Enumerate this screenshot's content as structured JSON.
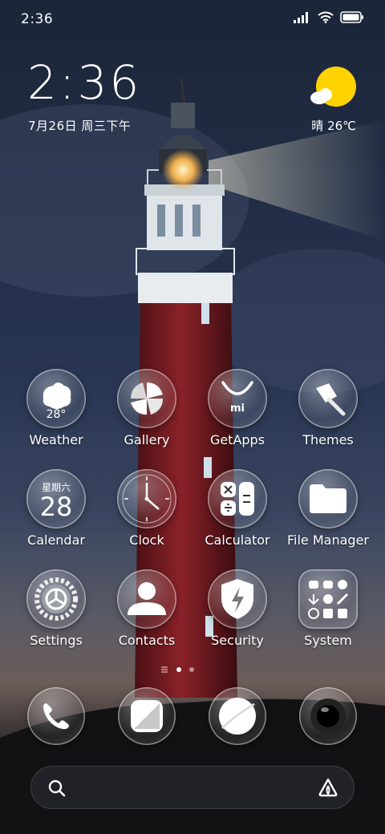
{
  "status_bar": {
    "time": "2:36"
  },
  "clock_widget": {
    "time": "2:36",
    "date": "7月26日 周三下午"
  },
  "weather_widget": {
    "condition": "晴",
    "temperature": "26℃"
  },
  "apps": [
    {
      "label": "Weather",
      "badge": "28°"
    },
    {
      "label": "Gallery"
    },
    {
      "label": "GetApps",
      "badge": "mi"
    },
    {
      "label": "Themes"
    },
    {
      "label": "Calendar",
      "weekday": "星期六",
      "day": "28"
    },
    {
      "label": "Clock"
    },
    {
      "label": "Calculator"
    },
    {
      "label": "File Manager"
    },
    {
      "label": "Settings"
    },
    {
      "label": "Contacts"
    },
    {
      "label": "Security"
    },
    {
      "label": "System"
    }
  ],
  "dock": [
    {
      "icon": "phone-icon"
    },
    {
      "icon": "notes-icon"
    },
    {
      "icon": "browser-icon"
    },
    {
      "icon": "camera-icon"
    }
  ],
  "pager": {
    "pages": 2,
    "current": 1
  },
  "colors": {
    "sun": "#FFD200",
    "lighthouse_red": "#7a1a1a",
    "sky": "#1c2740"
  }
}
